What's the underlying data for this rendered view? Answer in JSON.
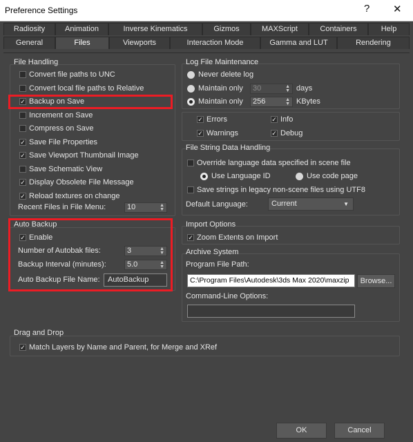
{
  "window": {
    "title": "Preference Settings",
    "help_glyph": "?",
    "close_glyph": "✕"
  },
  "tabs_row1": [
    "Radiosity",
    "Animation",
    "Inverse Kinematics",
    "Gizmos",
    "MAXScript",
    "Containers",
    "Help"
  ],
  "tabs_row2": [
    "General",
    "Files",
    "Viewports",
    "Interaction Mode",
    "Gamma and LUT",
    "Rendering"
  ],
  "active_tab": "Files",
  "file_handling": {
    "title": "File Handling",
    "options": [
      {
        "label": "Convert file paths to UNC",
        "checked": false
      },
      {
        "label": "Convert local file paths to Relative",
        "checked": false
      },
      {
        "label": "Backup on Save",
        "checked": true
      },
      {
        "label": "Increment on Save",
        "checked": false
      },
      {
        "label": "Compress on Save",
        "checked": false
      },
      {
        "label": "Save File Properties",
        "checked": true
      },
      {
        "label": "Save Viewport Thumbnail Image",
        "checked": true
      },
      {
        "label": "Save Schematic View",
        "checked": false
      },
      {
        "label": "Display Obsolete File Message",
        "checked": true
      },
      {
        "label": "Reload textures on change",
        "checked": true
      }
    ],
    "recent_files_label": "Recent Files in File Menu:",
    "recent_files_value": "10"
  },
  "auto_backup": {
    "title": "Auto Backup",
    "enable_label": "Enable",
    "enable_checked": true,
    "num_files_label": "Number of Autobak files:",
    "num_files_value": "3",
    "interval_label": "Backup Interval (minutes):",
    "interval_value": "5.0",
    "file_name_label": "Auto Backup File Name:",
    "file_name_value": "AutoBackup"
  },
  "log_file": {
    "title": "Log File Maintenance",
    "never_delete": "Never delete log",
    "maintain_only": "Maintain only",
    "days_value": "30",
    "days_unit": "days",
    "kb_value": "256",
    "kb_unit": "KBytes",
    "selected": "maintain_kb",
    "errors": "Errors",
    "info": "Info",
    "warnings": "Warnings",
    "debug": "Debug"
  },
  "string_handling": {
    "title": "File String Data Handling",
    "override_label": "Override language data specified in scene file",
    "use_language_id": "Use Language ID",
    "use_code_page": "Use code page",
    "save_utf8": "Save strings in legacy non-scene files using UTF8",
    "default_language_label": "Default Language:",
    "default_language_value": "Current"
  },
  "import_options": {
    "title": "Import Options",
    "zoom_extents": "Zoom Extents on Import"
  },
  "archive": {
    "title": "Archive System",
    "program_path_label": "Program File Path:",
    "program_path_value": "C:\\Program Files\\Autodesk\\3ds Max 2020\\maxzip",
    "browse_label": "Browse...",
    "cmdline_label": "Command-Line Options:",
    "cmdline_value": ""
  },
  "drag_drop": {
    "title": "Drag and Drop",
    "match_layers": "Match Layers by Name and Parent, for Merge and XRef"
  },
  "footer": {
    "ok": "OK",
    "cancel": "Cancel"
  },
  "colors": {
    "highlight": "#ec1c24",
    "background": "#444444"
  }
}
